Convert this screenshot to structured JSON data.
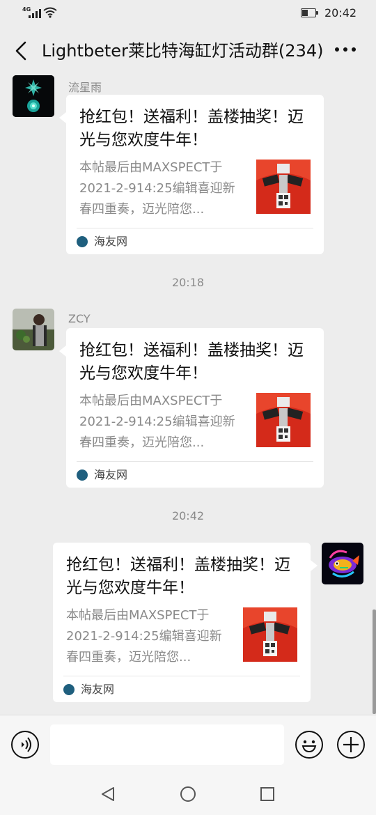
{
  "status_bar": {
    "network": "4G",
    "time": "20:42"
  },
  "header": {
    "title": "Lightbeter莱比特海缸灯活动群(234)",
    "back_icon": "chevron-left-icon",
    "more_icon": "more-dots-icon"
  },
  "messages": [
    {
      "sender": "流星雨",
      "side": "left",
      "card": {
        "title": "抢红包！送福利！盖楼抽奖！迈光与您欢度牛年！",
        "description": "本帖最后由MAXSPECT于2021-2-914:25编辑喜迎新春四重奏，迈光陪您...",
        "source": "海友网"
      }
    },
    {
      "timestamp": "20:18",
      "sender": "ZCY",
      "side": "left",
      "card": {
        "title": "抢红包！送福利！盖楼抽奖！迈光与您欢度牛年！",
        "description": "本帖最后由MAXSPECT于2021-2-914:25编辑喜迎新春四重奏，迈光陪您...",
        "source": "海友网"
      }
    },
    {
      "timestamp": "20:42",
      "sender": "",
      "side": "right",
      "card": {
        "title": "抢红包！送福利！盖楼抽奖！迈光与您欢度牛年！",
        "description": "本帖最后由MAXSPECT于2021-2-914:25编辑喜迎新春四重奏，迈光陪您...",
        "source": "海友网"
      }
    }
  ],
  "input_bar": {
    "voice_icon": "voice-icon",
    "emoji_icon": "emoji-icon",
    "plus_icon": "plus-icon",
    "text_value": ""
  },
  "colors": {
    "background": "#ededed",
    "card": "#ffffff",
    "thumbnail_red": "#d42a1a"
  }
}
